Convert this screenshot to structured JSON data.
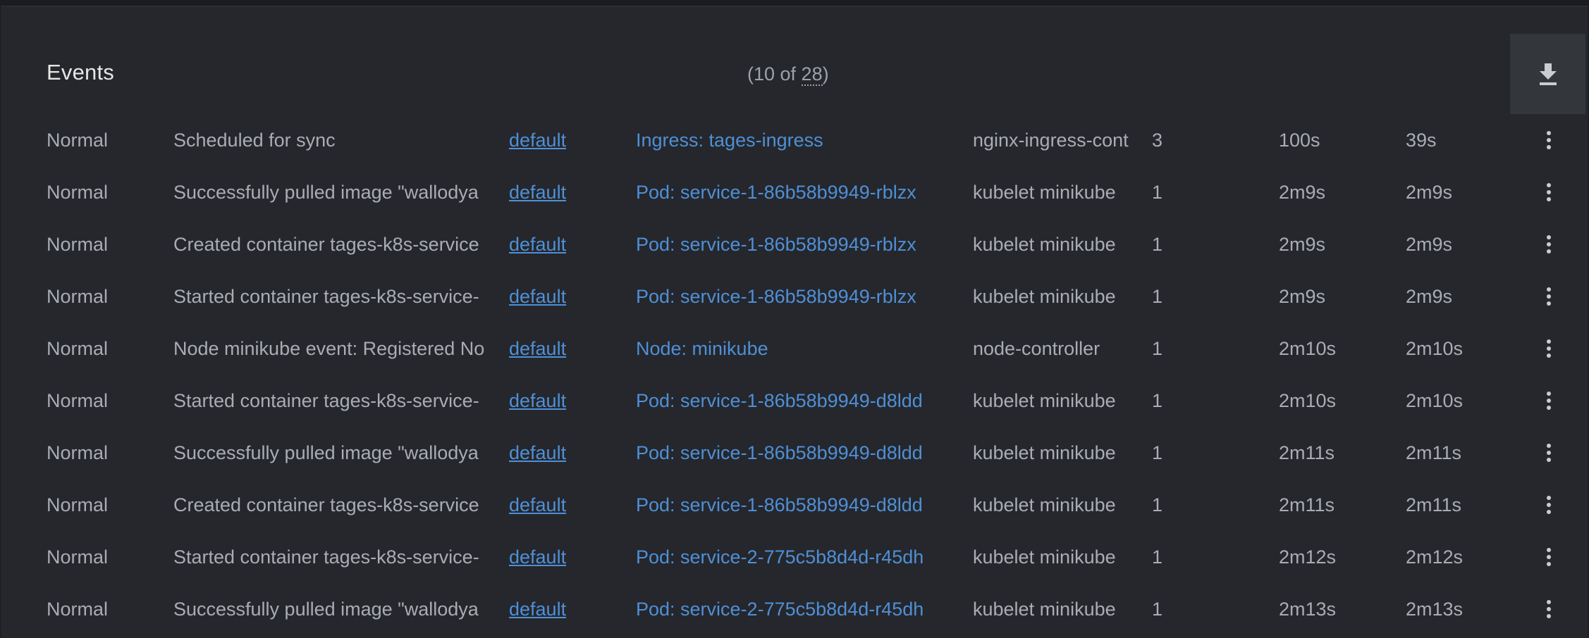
{
  "panel": {
    "title": "Events",
    "count_prefix": "(10 of ",
    "count_total": "28",
    "count_suffix": ")"
  },
  "icons": {
    "download": "download-icon",
    "row_menu": "more-vertical-icon"
  },
  "colors": {
    "link": "#4f8fd6",
    "background": "#25272c",
    "text": "#a9adb3"
  },
  "events": [
    {
      "type": "Normal",
      "message": "Scheduled for sync",
      "namespace": "default",
      "object": "Ingress: tages-ingress",
      "source": "nginx-ingress-cont",
      "count": "3",
      "first_seen": "100s",
      "last_seen": "39s"
    },
    {
      "type": "Normal",
      "message": "Successfully pulled image \"wallodya",
      "namespace": "default",
      "object": "Pod: service-1-86b58b9949-rblzx",
      "source": "kubelet minikube",
      "count": "1",
      "first_seen": "2m9s",
      "last_seen": "2m9s"
    },
    {
      "type": "Normal",
      "message": "Created container tages-k8s-service",
      "namespace": "default",
      "object": "Pod: service-1-86b58b9949-rblzx",
      "source": "kubelet minikube",
      "count": "1",
      "first_seen": "2m9s",
      "last_seen": "2m9s"
    },
    {
      "type": "Normal",
      "message": "Started container tages-k8s-service-",
      "namespace": "default",
      "object": "Pod: service-1-86b58b9949-rblzx",
      "source": "kubelet minikube",
      "count": "1",
      "first_seen": "2m9s",
      "last_seen": "2m9s"
    },
    {
      "type": "Normal",
      "message": "Node minikube event: Registered No",
      "namespace": "default",
      "object": "Node: minikube",
      "source": "node-controller",
      "count": "1",
      "first_seen": "2m10s",
      "last_seen": "2m10s"
    },
    {
      "type": "Normal",
      "message": "Started container tages-k8s-service-",
      "namespace": "default",
      "object": "Pod: service-1-86b58b9949-d8ldd",
      "source": "kubelet minikube",
      "count": "1",
      "first_seen": "2m10s",
      "last_seen": "2m10s"
    },
    {
      "type": "Normal",
      "message": "Successfully pulled image \"wallodya",
      "namespace": "default",
      "object": "Pod: service-1-86b58b9949-d8ldd",
      "source": "kubelet minikube",
      "count": "1",
      "first_seen": "2m11s",
      "last_seen": "2m11s"
    },
    {
      "type": "Normal",
      "message": "Created container tages-k8s-service",
      "namespace": "default",
      "object": "Pod: service-1-86b58b9949-d8ldd",
      "source": "kubelet minikube",
      "count": "1",
      "first_seen": "2m11s",
      "last_seen": "2m11s"
    },
    {
      "type": "Normal",
      "message": "Started container tages-k8s-service-",
      "namespace": "default",
      "object": "Pod: service-2-775c5b8d4d-r45dh",
      "source": "kubelet minikube",
      "count": "1",
      "first_seen": "2m12s",
      "last_seen": "2m12s"
    },
    {
      "type": "Normal",
      "message": "Successfully pulled image \"wallodya",
      "namespace": "default",
      "object": "Pod: service-2-775c5b8d4d-r45dh",
      "source": "kubelet minikube",
      "count": "1",
      "first_seen": "2m13s",
      "last_seen": "2m13s"
    }
  ]
}
